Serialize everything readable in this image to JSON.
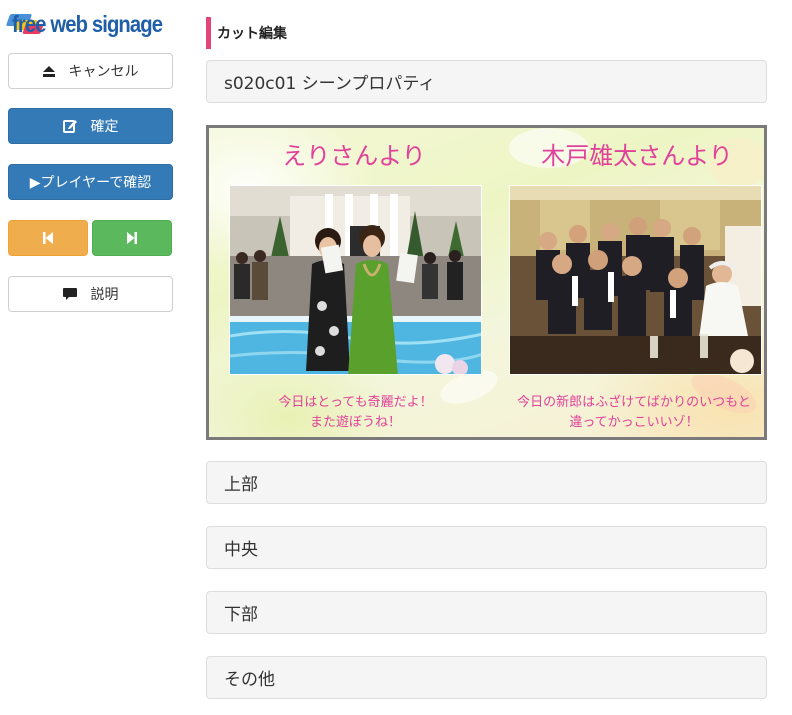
{
  "logo": {
    "text": "free web signage"
  },
  "sidebar": {
    "cancel_label": "キャンセル",
    "confirm_label": "確定",
    "player_label": "▶プレイヤーで確認",
    "description_label": "説明"
  },
  "main": {
    "section_title": "カット編集",
    "panels": {
      "scene_properties": "s020c01 シーンプロパティ",
      "top": "上部",
      "center": "中央",
      "bottom": "下部",
      "other": "その他"
    }
  },
  "preview": {
    "left": {
      "title": "えりさんより",
      "line1": "今日はとっても奇麗だよ！",
      "line2": "また遊ぼうね！"
    },
    "right": {
      "title": "木戸雄太さんより",
      "line1": "今日の新郎はふざけてばかりのいつもと",
      "line2": "違ってかっこいいゾ！"
    }
  },
  "colors": {
    "primary": "#337ab7",
    "warning": "#f0ad4e",
    "success": "#5cb85c",
    "accent": "#e3457a",
    "message_pink": "#e0419a"
  },
  "icons": {
    "cancel": "eject-icon",
    "confirm": "edit-icon",
    "prev": "step-backward-icon",
    "next": "step-forward-icon",
    "description": "comment-icon"
  }
}
